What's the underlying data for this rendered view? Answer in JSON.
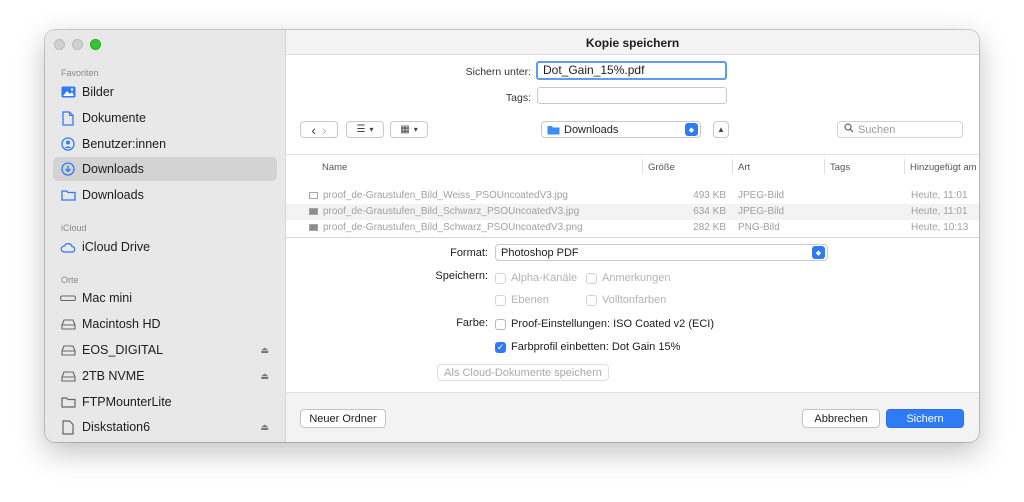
{
  "window": {
    "title": "Kopie speichern"
  },
  "sidebar": {
    "sections": [
      {
        "label": "Favoriten",
        "items": [
          {
            "label": "Bilder",
            "icon": "photo-icon"
          },
          {
            "label": "Dokumente",
            "icon": "document-icon"
          },
          {
            "label": "Benutzer:innen",
            "icon": "user-circle-icon"
          },
          {
            "label": "Downloads",
            "icon": "download-circle-icon",
            "selected": true
          },
          {
            "label": "Downloads",
            "icon": "folder-icon"
          }
        ]
      },
      {
        "label": "iCloud",
        "items": [
          {
            "label": "iCloud Drive",
            "icon": "cloud-icon"
          }
        ]
      },
      {
        "label": "Orte",
        "items": [
          {
            "label": "Mac mini",
            "icon": "mac-mini-icon"
          },
          {
            "label": "Macintosh HD",
            "icon": "drive-icon"
          },
          {
            "label": "EOS_DIGITAL",
            "icon": "drive-icon",
            "eject": true
          },
          {
            "label": "2TB NVME",
            "icon": "drive-icon",
            "eject": true
          },
          {
            "label": "FTPMounterLite",
            "icon": "folder-icon"
          },
          {
            "label": "Diskstation6",
            "icon": "document-icon",
            "eject": true
          }
        ]
      }
    ]
  },
  "save": {
    "save_as_label": "Sichern unter:",
    "filename": "Dot_Gain_15%.pdf",
    "tags_label": "Tags:",
    "tags_value": ""
  },
  "toolbar": {
    "back": "‹",
    "forward": "›",
    "location": "Downloads",
    "search_placeholder": "Suchen"
  },
  "list": {
    "columns": {
      "name": "Name",
      "size": "Größe",
      "kind": "Art",
      "tags": "Tags",
      "added": "Hinzugefügt am"
    },
    "rows": [
      {
        "name": "proof_de-Graustufen_Bild_Weiss_PSOUncoatedV3.jpg",
        "size": "493 KB",
        "kind": "JPEG-Bild",
        "added": "Heute, 11:01"
      },
      {
        "name": "proof_de-Graustufen_Bild_Schwarz_PSOUncoatedV3.jpg",
        "size": "634 KB",
        "kind": "JPEG-Bild",
        "added": "Heute, 11:01"
      },
      {
        "name": "proof_de-Graustufen_Bild_Schwarz_PSOUncoatedV3.png",
        "size": "282 KB",
        "kind": "PNG-Bild",
        "added": "Heute, 10:13"
      }
    ]
  },
  "options": {
    "format_label": "Format:",
    "format_value": "Photoshop PDF",
    "speichern_label": "Speichern:",
    "alpha": "Alpha-Kanäle",
    "anmerkungen": "Anmerkungen",
    "ebenen": "Ebenen",
    "volltonfarben": "Volltonfarben",
    "farbe_label": "Farbe:",
    "proof": "Proof-Einstellungen: ISO Coated v2 (ECI)",
    "farbprofil": "Farbprofil einbetten: Dot Gain 15%",
    "cloud_button": "Als Cloud-Dokumente speichern"
  },
  "buttons": {
    "new_folder": "Neuer Ordner",
    "cancel": "Abbrechen",
    "save": "Sichern"
  },
  "colors": {
    "accent": "#2e7bf6",
    "sidebar_bg": "#e8e8e8",
    "selected_bg": "#d3d3d3"
  }
}
